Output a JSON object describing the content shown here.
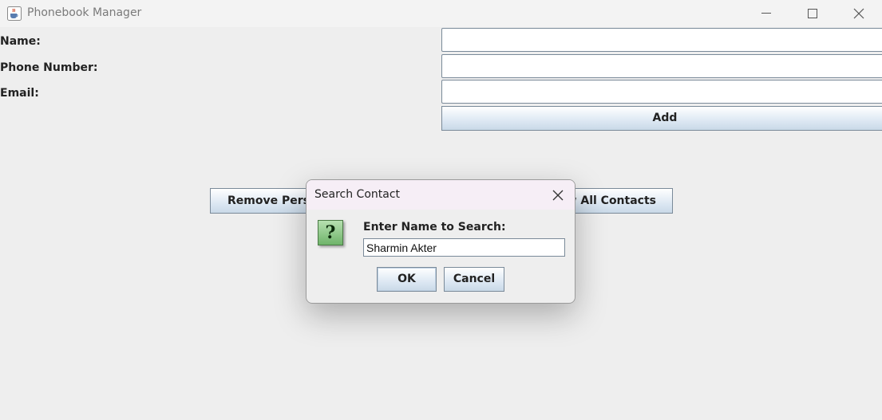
{
  "window": {
    "title": "Phonebook Manager",
    "app_icon": "java-coffee-cup-icon"
  },
  "form": {
    "name_label": "Name:",
    "phone_label": "Phone Number:",
    "email_label": "Email:",
    "name_value": "",
    "phone_value": "",
    "email_value": "",
    "add_button": "Add"
  },
  "actions": {
    "remove_button": "Remove Person",
    "view_all_button": "View All Contacts"
  },
  "dialog": {
    "title": "Search Contact",
    "icon": "question-icon",
    "prompt": "Enter Name to Search:",
    "input_value": "Sharmin Akter",
    "ok_button": "OK",
    "cancel_button": "Cancel"
  },
  "colors": {
    "background": "#eeeeee",
    "dialog_titlebar": "#f6eef6",
    "button_gradient_bottom": "#c9d9e8",
    "border": "#7a8a99"
  }
}
